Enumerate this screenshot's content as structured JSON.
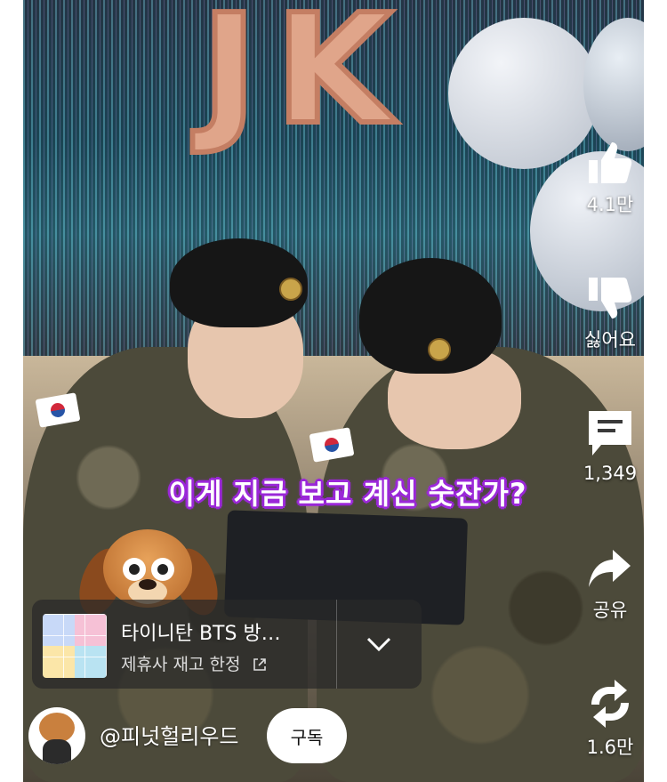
{
  "video": {
    "caption": "이게 지금 보고 계신 숫잔가?",
    "decor_letters": "JK"
  },
  "actions": {
    "like": {
      "icon": "thumbs-up-icon",
      "label": "4.1만"
    },
    "dislike": {
      "icon": "thumbs-down-icon",
      "label": "싫어요"
    },
    "comments": {
      "icon": "comment-icon",
      "label": "1,349"
    },
    "share": {
      "icon": "share-icon",
      "label": "공유"
    },
    "remix": {
      "icon": "remix-icon",
      "label": "1.6만"
    }
  },
  "product": {
    "title": "타이니탄 BTS 방…",
    "subtitle": "제휴사 재고 한정"
  },
  "channel": {
    "handle": "@피넛헐리우드",
    "subscribe_label": "구독"
  },
  "colors": {
    "caption_outline": "#9b28d8",
    "overlay_card": "#282828"
  }
}
